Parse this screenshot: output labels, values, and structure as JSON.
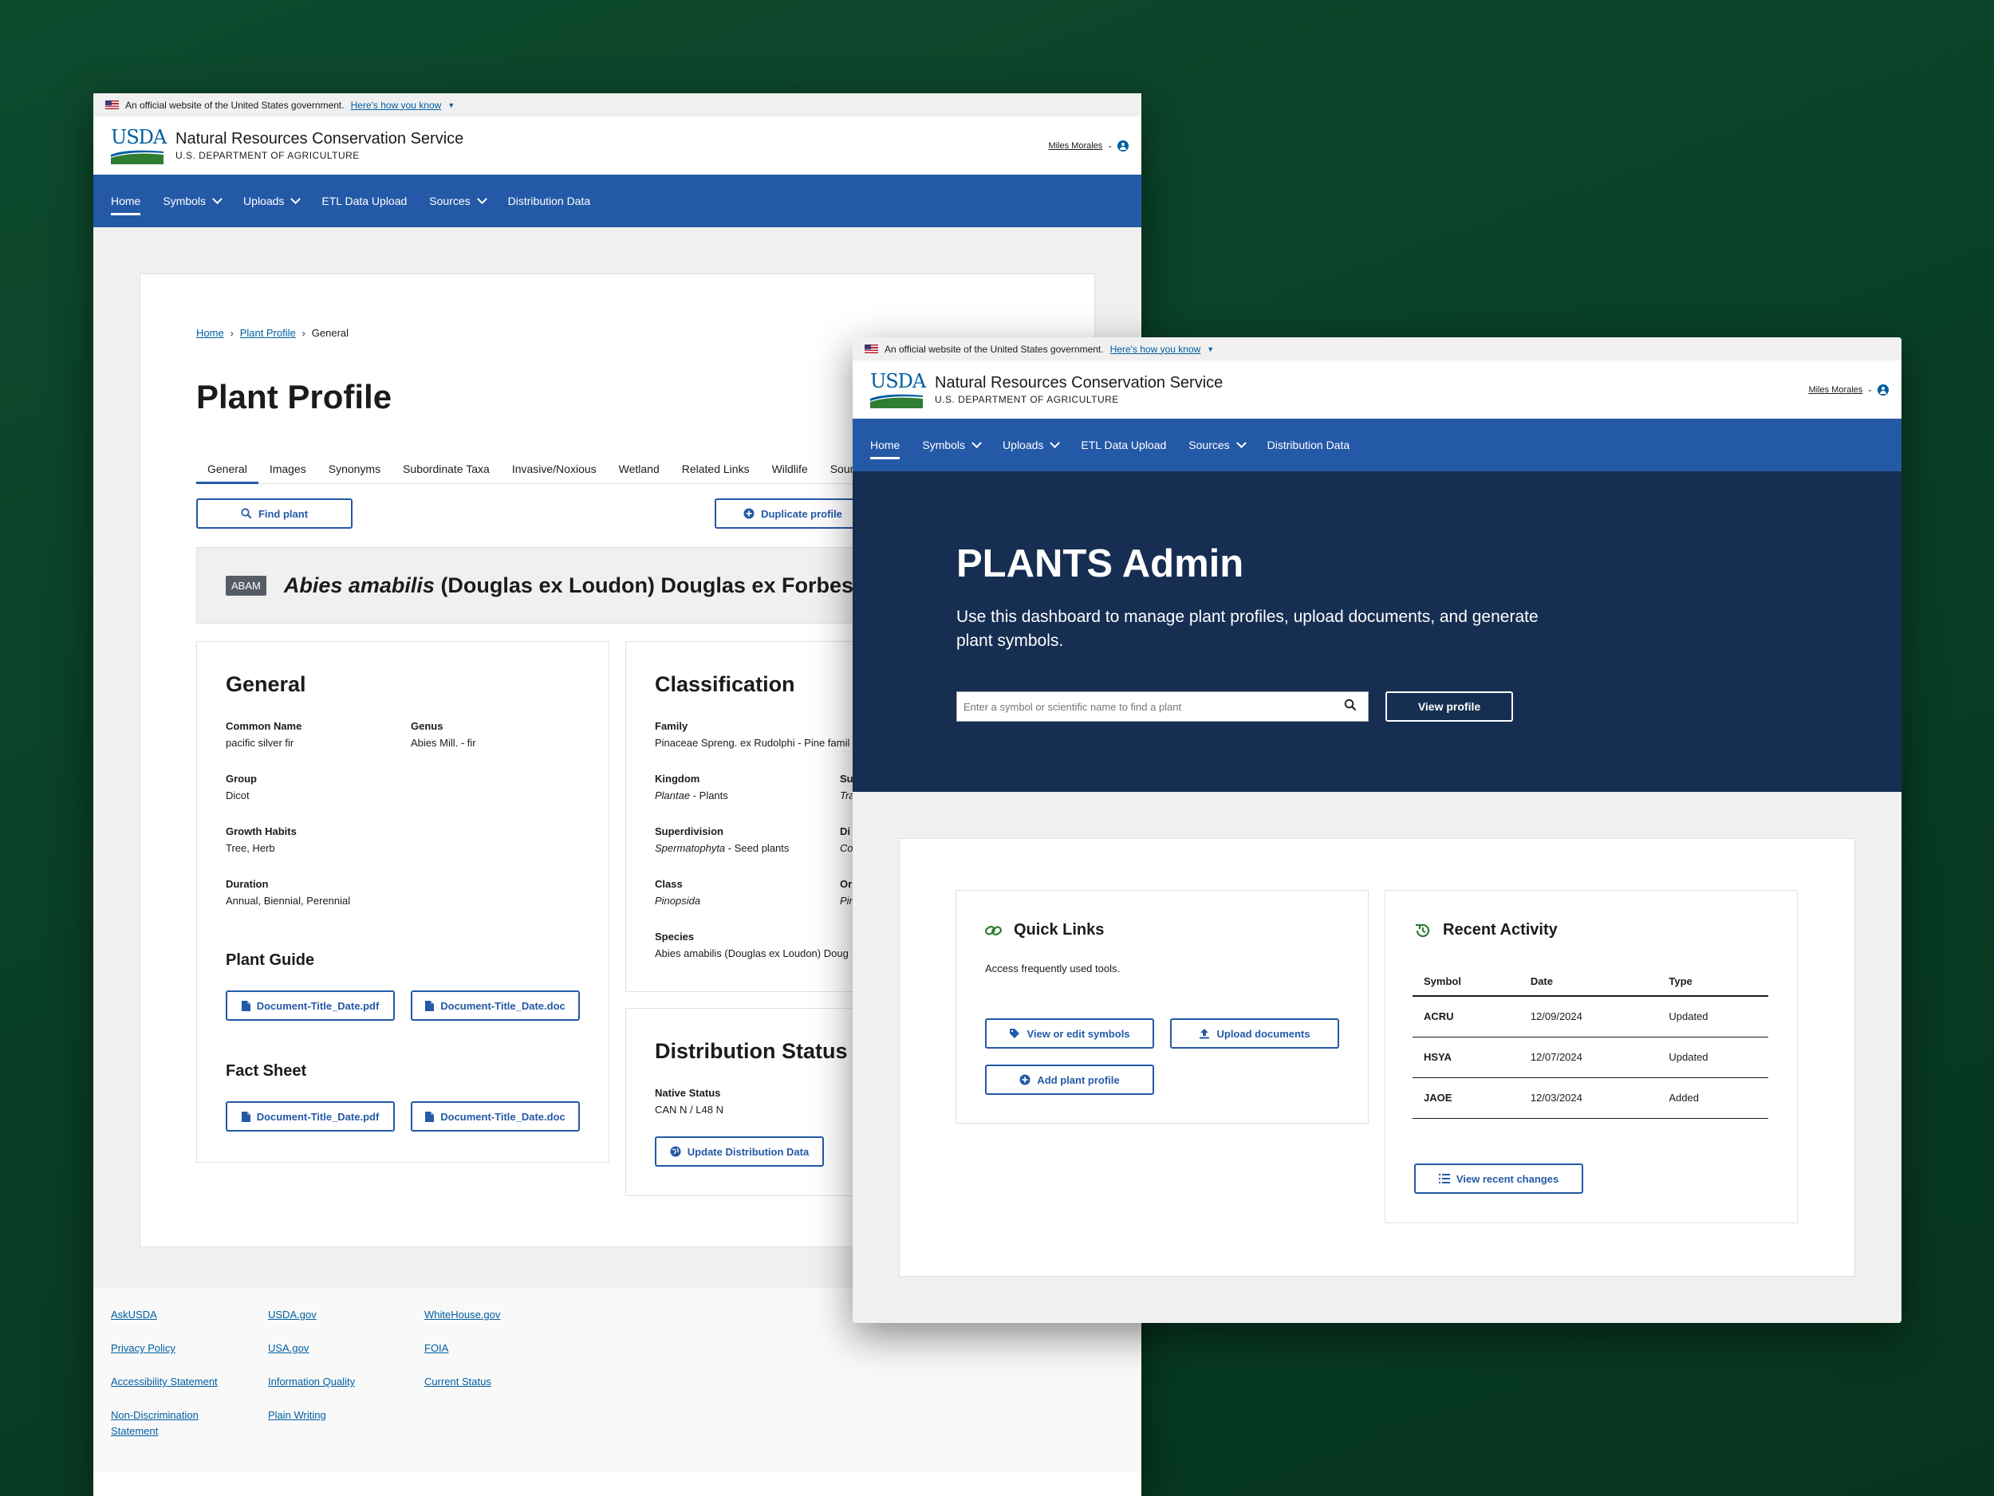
{
  "gov_banner": {
    "text": "An official website of the United States government.",
    "link": "Here's how you know"
  },
  "header": {
    "logo": "USDA",
    "agency": "Natural Resources Conservation Service",
    "department": "U.S. DEPARTMENT OF AGRICULTURE",
    "user": "Miles Morales"
  },
  "nav": [
    "Home",
    "Symbols",
    "Uploads",
    "ETL Data Upload",
    "Sources",
    "Distribution Data"
  ],
  "profile": {
    "breadcrumb": [
      "Home",
      "Plant Profile",
      "General"
    ],
    "title": "Plant Profile",
    "tabs": [
      "General",
      "Images",
      "Synonyms",
      "Subordinate Taxa",
      "Invasive/Noxious",
      "Wetland",
      "Related Links",
      "Wildlife",
      "Sour"
    ],
    "find_plant": "Find plant",
    "duplicate_profile": "Duplicate profile",
    "symbol": "ABAM",
    "sci_genus_species": "Abies amabilis",
    "sci_author": " (Douglas ex Loudon) Douglas ex Forbes",
    "general": {
      "heading": "General",
      "fields": [
        {
          "label": "Common Name",
          "value": "pacific silver fir"
        },
        {
          "label": "Genus",
          "value": "Abies Mill. - fir"
        },
        {
          "label": "Group",
          "value": "Dicot"
        },
        {
          "label": "Growth Habits",
          "value": "Tree, Herb"
        },
        {
          "label": "Duration",
          "value": "Annual, Biennial, Perennial"
        }
      ],
      "plant_guide": "Plant Guide",
      "fact_sheet": "Fact Sheet",
      "doc_pdf": "Document-Title_Date.pdf",
      "doc_doc": "Document-Title_Date.doc"
    },
    "classification": {
      "heading": "Classification",
      "family_label": "Family",
      "family_value": "Pinaceae Spreng. ex Rudolphi - Pine famil",
      "kingdom_label": "Kingdom",
      "kingdom_italic": "Plantae",
      "kingdom_rest": " - Plants",
      "superdivision_label": "Superdivision",
      "superdivision_italic": "Spermatophyta",
      "superdivision_rest": " - Seed plants",
      "class_label": "Class",
      "class_value": "Pinopsida",
      "species_label": "Species",
      "species_value": "Abies amabilis (Douglas ex Loudon) Doug",
      "col2_labels": [
        "Su",
        "Di",
        "Or"
      ],
      "col2_values": [
        "Tra",
        "Co",
        "Pin"
      ]
    },
    "distribution": {
      "heading": "Distribution Status",
      "native_label": "Native Status",
      "native_value": "CAN N / L48 N",
      "update_button": "Update Distribution Data"
    }
  },
  "footer": {
    "col1": [
      "AskUSDA",
      "Privacy Policy",
      "Accessibility Statement",
      "Non-Discrimination Statement"
    ],
    "col2": [
      "USDA.gov",
      "USA.gov",
      "Information Quality",
      "Plain Writing"
    ],
    "col3": [
      "WhiteHouse.gov",
      "FOIA",
      "Current Status"
    ]
  },
  "admin": {
    "title": "PLANTS Admin",
    "subtitle": "Use this dashboard to manage plant profiles, upload documents, and generate plant symbols.",
    "search_placeholder": "Enter a symbol or scientific name to find a plant",
    "view_profile": "View profile",
    "quick_links": {
      "heading": "Quick Links",
      "description": "Access frequently used tools.",
      "buttons": [
        "View or edit symbols",
        "Upload documents",
        "Add plant profile"
      ]
    },
    "recent_activity": {
      "heading": "Recent Activity",
      "columns": [
        "Symbol",
        "Date",
        "Type"
      ],
      "rows": [
        [
          "ACRU",
          "12/09/2024",
          "Updated"
        ],
        [
          "HSYA",
          "12/07/2024",
          "Updated"
        ],
        [
          "JAOE",
          "12/03/2024",
          "Added"
        ]
      ],
      "view_changes": "View recent changes"
    }
  },
  "colors": {
    "primary": "#2459a7",
    "hero": "#162e51",
    "link": "#005ea2",
    "usda_green": "#2e7d32"
  }
}
